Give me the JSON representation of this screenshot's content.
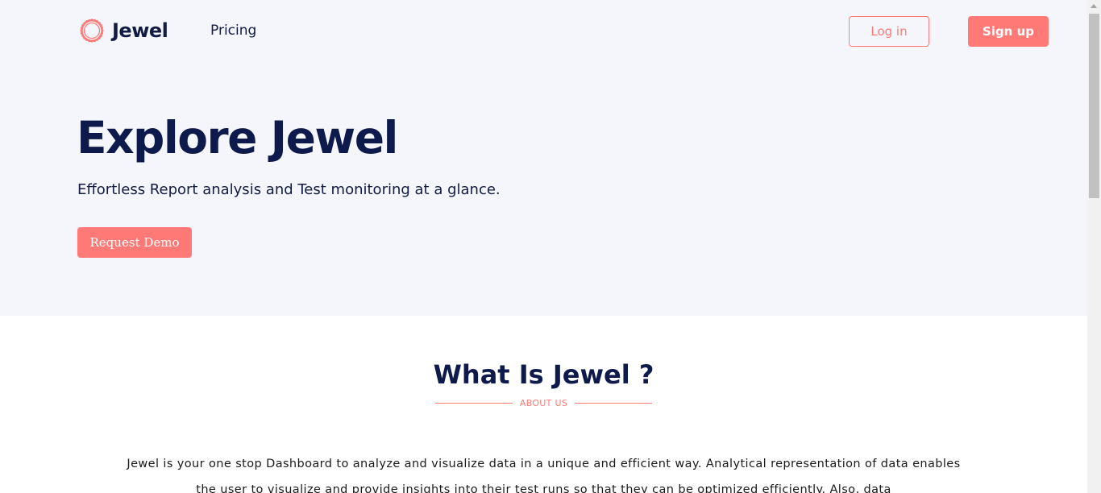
{
  "colors": {
    "accent": "#ff7a77",
    "navy": "#0e1a4c",
    "hero_background": "#f5f6fb",
    "body_background": "#ffffff"
  },
  "header": {
    "logo_icon": "hexagon-ring-logo-icon",
    "brand": "Jewel",
    "nav": {
      "pricing": "Pricing"
    },
    "login_label": "Log in",
    "signup_label": "Sign up"
  },
  "hero": {
    "title": "Explore Jewel",
    "subtitle": "Effortless Report analysis and Test monitoring at a glance.",
    "cta_label": "Request Demo"
  },
  "about": {
    "title": "What Is Jewel ?",
    "eyebrow": "ABOUT US",
    "text": "Jewel is your one stop Dashboard to analyze and visualize data in a unique and efficient way. Analytical representation of data enables the user to visualize and provide insights into their test runs so that they can be optimized efficiently. Also, data"
  }
}
